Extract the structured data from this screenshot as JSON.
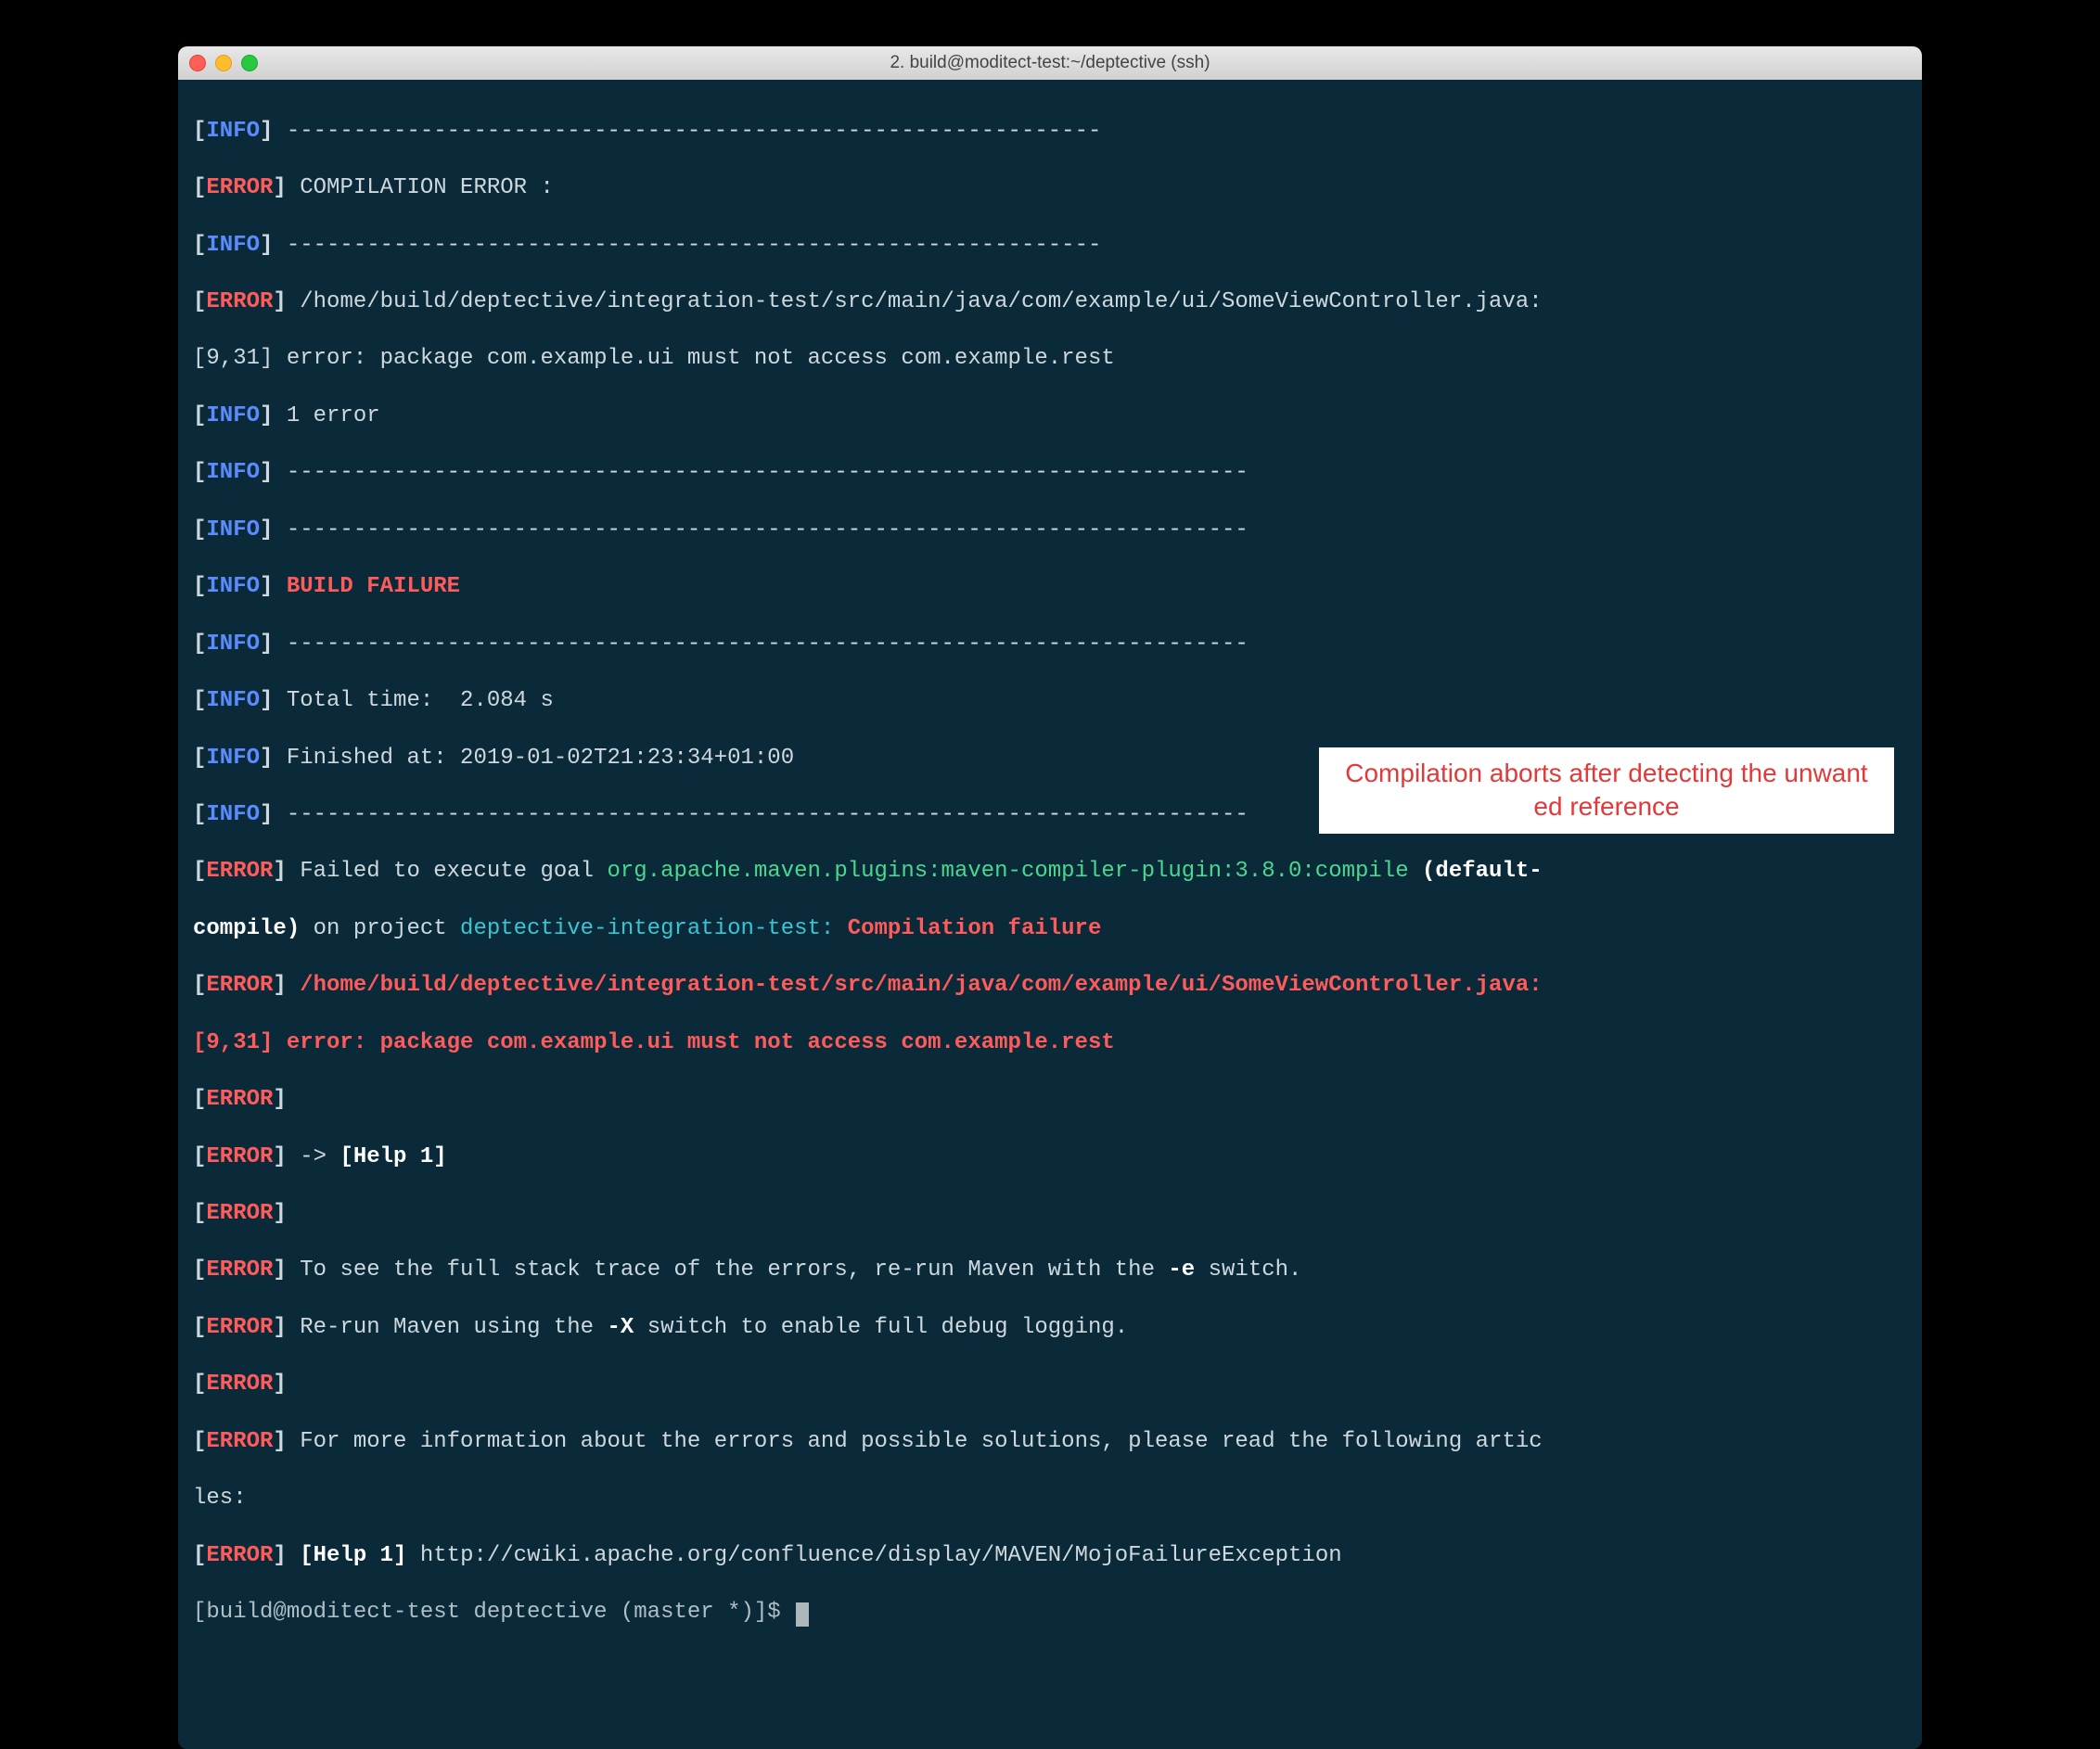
{
  "window": {
    "title": "2. build@moditect-test:~/deptective (ssh)"
  },
  "labels": {
    "info": "INFO",
    "error": "ERROR"
  },
  "dashes": {
    "d1": " -------------------------------------------------------------",
    "d2": " -------------------------------------------------------------",
    "d3": " ------------------------------------------------------------------------",
    "d4": " ------------------------------------------------------------------------",
    "d5": " ------------------------------------------------------------------------",
    "d6": " ------------------------------------------------------------------------",
    "d7": " ------------------------------------------------------------------------"
  },
  "lines": {
    "compilation_error": " COMPILATION ERROR : ",
    "file_path": " /home/build/deptective/integration-test/src/main/java/com/example/ui/SomeViewController.java:",
    "err_detail": "[9,31] error: package com.example.ui must not access com.example.rest",
    "one_error": " 1 error",
    "build_failure": " BUILD FAILURE",
    "total_time": " Total time:  2.084 s",
    "finished_at": " Finished at: 2019-01-02T21:23:34+01:00",
    "failed_prefix": " Failed to execute goal ",
    "goal": "org.apache.maven.plugins:maven-compiler-plugin:3.8.0:compile",
    "default_compile_open": " (default-",
    "default_compile_cont": "compile)",
    "on_project": " on project ",
    "project_name": "deptective-integration-test: ",
    "comp_failure": "Compilation failure",
    "help1": " -> ",
    "help1_bold": "[Help 1]",
    "stack_trace": " To see the full stack trace of the errors, re-run Maven with the ",
    "e_switch": "-e",
    "switch_suffix": " switch.",
    "rerun_x": " Re-run Maven using the ",
    "x_switch": "-X",
    "rerun_x_suffix": " switch to enable full debug logging.",
    "more_info": " For more information about the errors and possible solutions, please read the following artic",
    "more_info_cont": "les:",
    "help1_link_label": " [Help 1]",
    "help1_url": " http://cwiki.apache.org/confluence/display/MAVEN/MojoFailureException",
    "prompt": "[build@moditect-test deptective (master *)]$ "
  },
  "annotation": {
    "text": "Compilation aborts after detecting the unwanted reference"
  }
}
